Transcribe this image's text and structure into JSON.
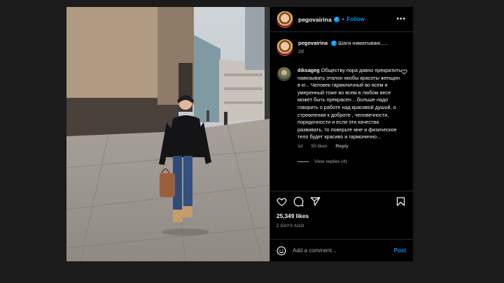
{
  "post": {
    "username": "pegovairina",
    "follow_label": "Follow",
    "more_label": "•••",
    "caption_text": "Шаги наматываю.....",
    "caption_time": "2d",
    "likes": "25,349 likes",
    "date": "2 DAYS AGO"
  },
  "comment": {
    "username": "diksageg",
    "text": "Обществу пора давно прекратить навязывать эталон якобы красоты женщин в кг... Человек гармоничный во всем и умеренный тоже во всем в любом весе может быть прекрасен ...больше надо говорить о работе над красивой душой, о стремлении к доброте , человечности, порядочности и если эти качества развивать, то поверьте мне и физическое тело будет красиво и гармонично...",
    "time": "1d",
    "likes": "50 likes",
    "reply_label": "Reply",
    "view_replies": "View replies (4)"
  },
  "add_comment": {
    "placeholder": "Add a comment...",
    "post_label": "Post"
  },
  "icons": {
    "verified": "verified-badge-icon",
    "heart": "heart-icon",
    "comment": "comment-icon",
    "share": "share-icon",
    "save": "bookmark-icon",
    "emoji": "emoji-icon"
  },
  "colors": {
    "accent": "#0095f6",
    "background": "#000000",
    "secondary_text": "#a8a8a8"
  }
}
